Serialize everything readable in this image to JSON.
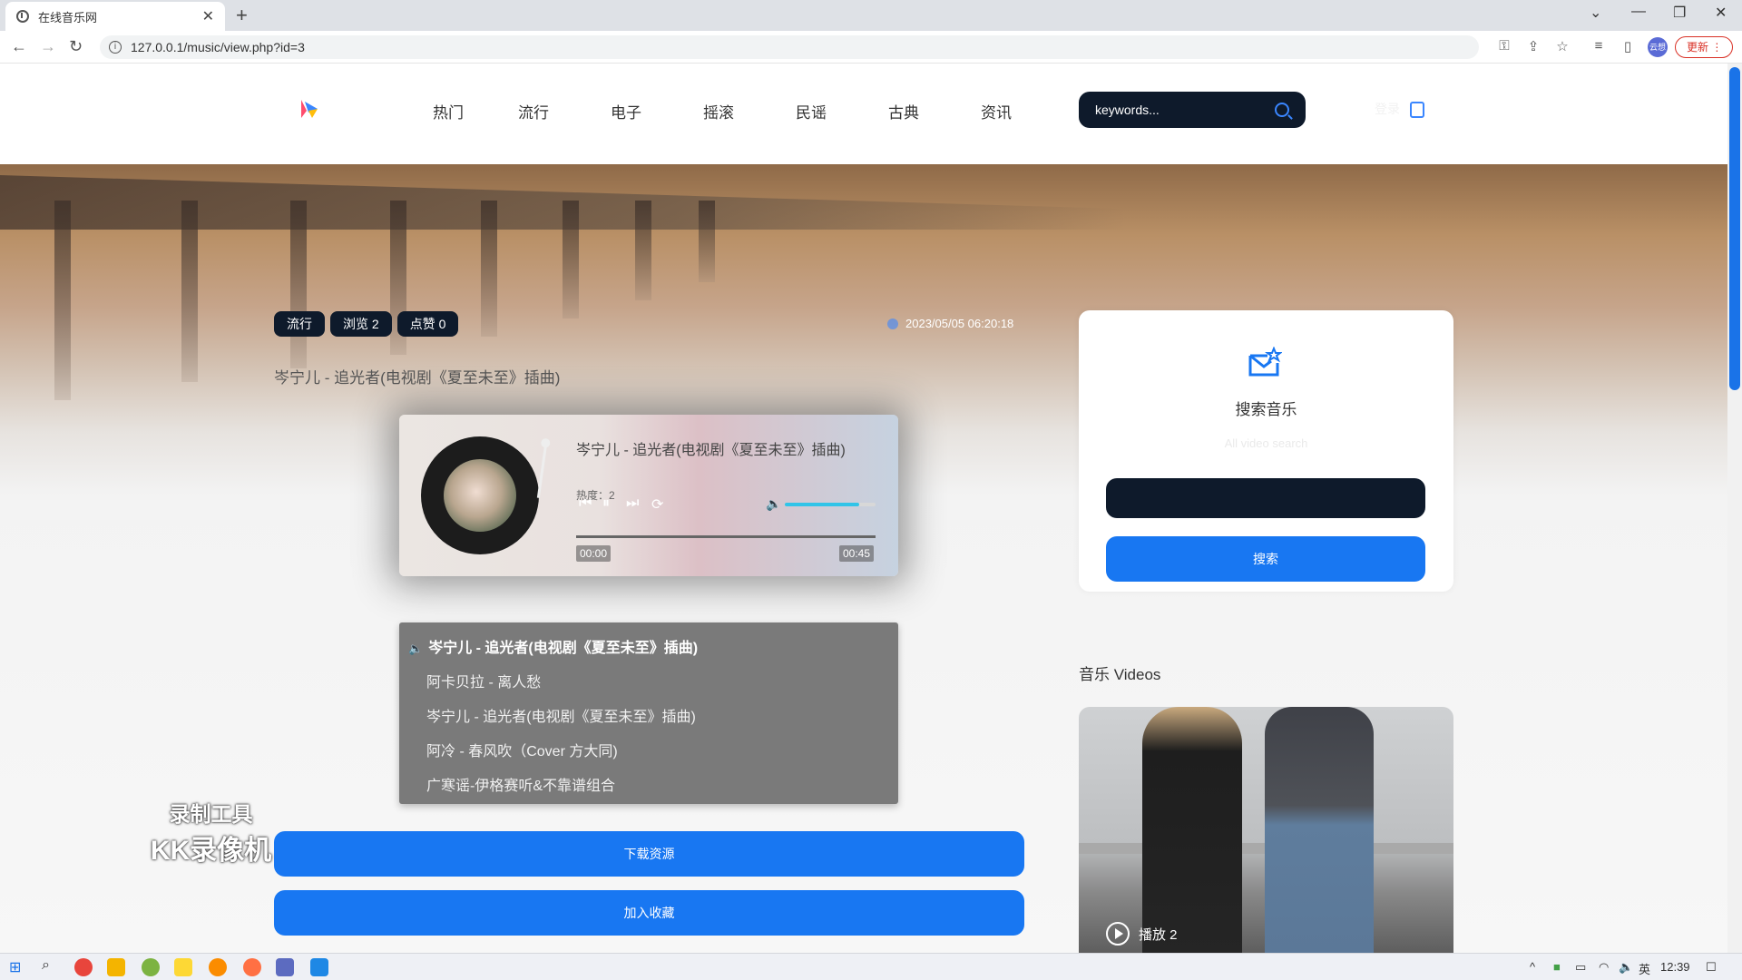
{
  "browser": {
    "tab_title": "在线音乐网",
    "url": "127.0.0.1/music/view.php?id=3",
    "profile_label": "云想",
    "update_label": "更新"
  },
  "header": {
    "nav": [
      "热门",
      "流行",
      "电子",
      "摇滚",
      "民谣",
      "古典",
      "资讯"
    ],
    "search_placeholder": "keywords...",
    "login_label": "登录"
  },
  "post": {
    "badges": [
      "流行",
      "浏览 2",
      "点赞 0"
    ],
    "date": "2023/05/05 06:20:18",
    "title": "岑宁儿 - 追光者(电视剧《夏至未至》插曲)"
  },
  "player": {
    "track_title": "岑宁儿 - 追光者(电视剧《夏至未至》插曲)",
    "subtitle": "热度：2",
    "current_time": "00:00",
    "duration": "00:45",
    "volume": 0.82,
    "progress": 0
  },
  "playlist": {
    "items": [
      "岑宁儿 - 追光者(电视剧《夏至未至》插曲)",
      "阿卡贝拉 - 离人愁",
      "岑宁儿 - 追光者(电视剧《夏至未至》插曲)",
      "阿冷 - 春风吹（Cover 方大同)",
      "广寒谣-伊格赛听&不靠谱组合"
    ],
    "active_index": 0
  },
  "actions": {
    "download_label": "下载资源",
    "favorite_label": "加入收藏"
  },
  "watermark": {
    "line1": "录制工具",
    "line2": "KK录像机"
  },
  "sidebar": {
    "search_title": "搜索音乐",
    "search_sub": "All video search",
    "search_button": "搜索",
    "videos_heading": "音乐 Videos",
    "video_play_label": "播放 2"
  },
  "taskbar": {
    "ime": "英",
    "clock": "12:39"
  },
  "colors": {
    "accent": "#1877f2",
    "dark": "#0e1a2b",
    "volume_fill": "#31c4e8"
  }
}
